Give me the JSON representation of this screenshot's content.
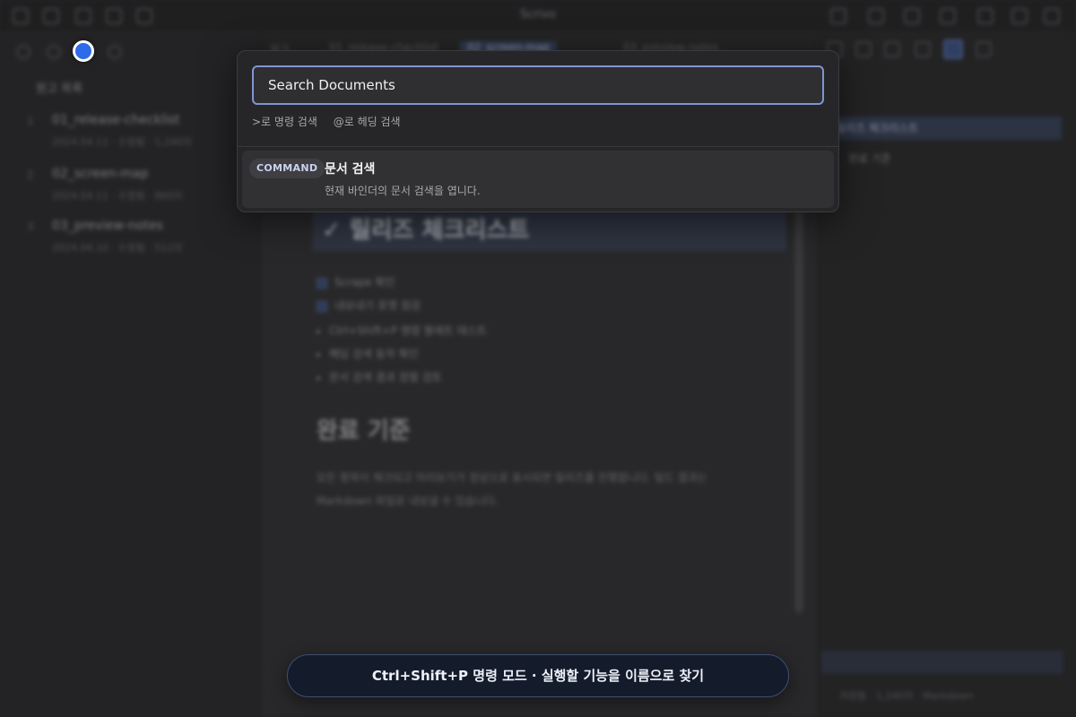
{
  "app": {
    "window_title": "Scrivo"
  },
  "sidebar": {
    "heading": "원고 목록",
    "items": [
      {
        "num": "1",
        "title": "01_release-checklist",
        "sub": "2024.04.11 · 수정됨 · 1,240자"
      },
      {
        "num": "2",
        "title": "02_screen-map",
        "sub": "2024.04.11 · 수정됨 · 860자"
      },
      {
        "num": "3",
        "title": "03_preview-notes",
        "sub": "2024.04.10 · 수정됨 · 512자"
      }
    ]
  },
  "editor": {
    "tabs": [
      {
        "label": "원고"
      },
      {
        "label": "01_release-checklist"
      },
      {
        "label": "02_screen-map"
      },
      {
        "label": "03_preview-notes"
      }
    ],
    "heading": "✓ 릴리즈 체크리스트",
    "checks": [
      {
        "text": "Scrape 확인",
        "checked": true
      },
      {
        "text": "내보내기 포맷 점검",
        "checked": true
      },
      {
        "text": "Ctrl+Shift+P 명령 팔레트 테스트",
        "checked": false
      },
      {
        "text": "헤딩 검색 동작 확인",
        "checked": false
      },
      {
        "text": "문서 검색 결과 정렬 검토",
        "checked": false
      }
    ],
    "section_heading": "완료 기준",
    "paragraph": "모든 항목이 체크되고 미리보기가 정상으로 표시되면 릴리즈를 진행합니다. 빌드 결과는 Markdown 파일로 내보낼 수 있습니다."
  },
  "right_panel": {
    "toc_active": "릴리즈 체크리스트",
    "toc_item": "완료 기준",
    "status": "저장됨 · 1,240자 · Markdown"
  },
  "palette": {
    "search": {
      "placeholder": "Search Documents",
      "value": ""
    },
    "hints": [
      ">로 명령 검색",
      "@로 헤딩 검색"
    ],
    "result": {
      "badge": "COMMAND",
      "title": "문서 검색",
      "description": "현재 바인더의 문서 검색을 엽니다."
    }
  },
  "tip": {
    "text": "Ctrl+Shift+P 명령 모드 · 실행할 기능을 이름으로 찾기"
  },
  "colors": {
    "accent": "#7f95d1",
    "focus_dot": "#2f6be8",
    "tip_bg": "#141b2b"
  }
}
